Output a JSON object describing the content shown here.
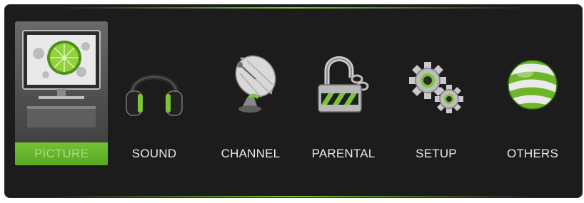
{
  "menu": {
    "selected": "PICTURE",
    "accent_color": "#6dbb2e",
    "items": [
      {
        "label": "PICTURE",
        "icon": "tv-monitor-icon"
      },
      {
        "label": "SOUND",
        "icon": "headphones-icon"
      },
      {
        "label": "CHANNEL",
        "icon": "satellite-dish-icon"
      },
      {
        "label": "PARENTAL",
        "icon": "padlock-icon"
      },
      {
        "label": "SETUP",
        "icon": "gears-icon"
      },
      {
        "label": "OTHERS",
        "icon": "striped-sphere-icon"
      }
    ]
  }
}
